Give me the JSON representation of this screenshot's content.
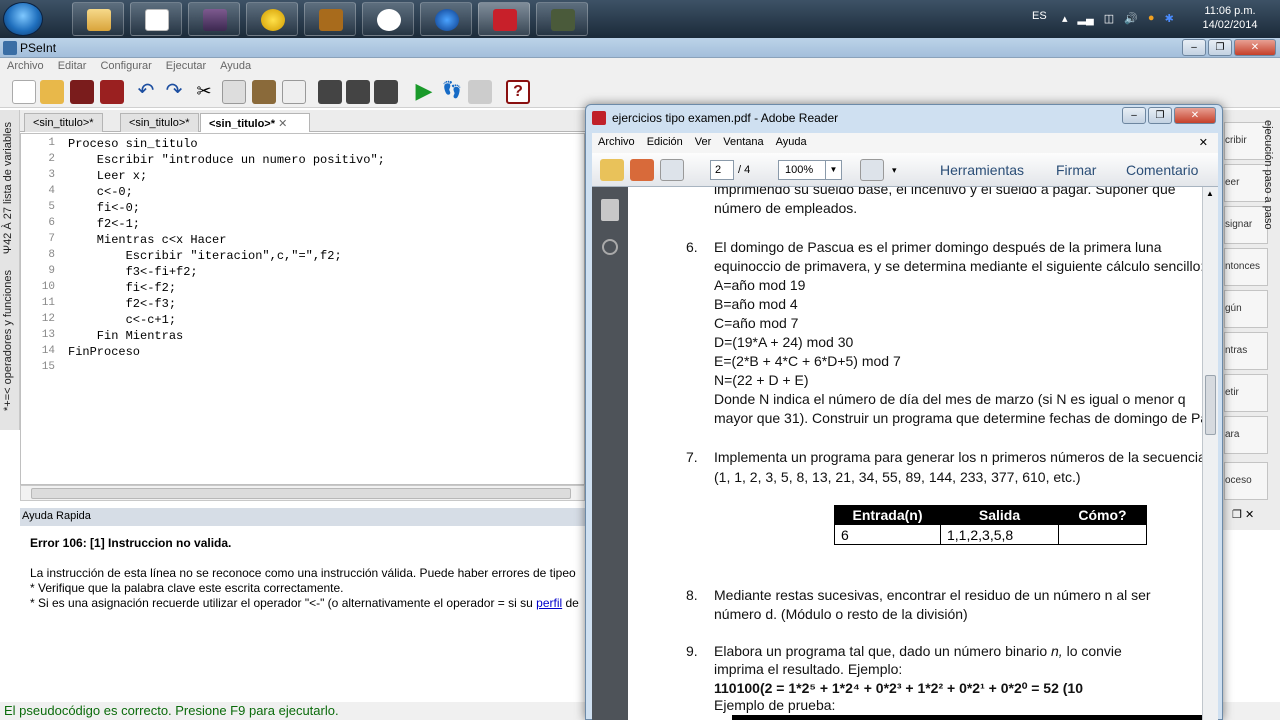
{
  "taskbar": {
    "language": "ES",
    "clock_time": "11:06 p.m.",
    "clock_date": "14/02/2014",
    "apps": [
      "windows-explorer-icon",
      "pseint-icon",
      "winrar-icon",
      "zip-icon",
      "dosbox-icon",
      "network-icon",
      "globe-icon",
      "acrobat-icon",
      "vlc-icon"
    ]
  },
  "pseint": {
    "title": "PSeInt",
    "menu": [
      "Archivo",
      "Editar",
      "Configurar",
      "Ejecutar",
      "Ayuda"
    ],
    "tabs": [
      "<sin_titulo>*",
      "<sin_titulo>*",
      "<sin_titulo>*"
    ],
    "left_panel_1": "lista de variables",
    "left_panel_2": "operadores y funciones",
    "left_panel_1_icons": "*+=<",
    "left_panel_2_icons": "Ψ42 À 27",
    "code_lines": [
      {
        "n": "1",
        "text": "Proceso sin_titulo"
      },
      {
        "n": "2",
        "text": "    Escribir \"introduce un numero positivo\";"
      },
      {
        "n": "3",
        "text": "    Leer x;"
      },
      {
        "n": "4",
        "text": "    c<-0;"
      },
      {
        "n": "5",
        "text": "    fi<-0;"
      },
      {
        "n": "6",
        "text": "    f2<-1;"
      },
      {
        "n": "7",
        "text": "    Mientras c<x Hacer"
      },
      {
        "n": "8",
        "text": "        Escribir \"iteracion\",c,\"=\",f2;"
      },
      {
        "n": "9",
        "text": "        f3<-fi+f2;"
      },
      {
        "n": "10",
        "text": "        fi<-f2;"
      },
      {
        "n": "11",
        "text": "        f2<-f3;"
      },
      {
        "n": "12",
        "text": "        c<-c+1;"
      },
      {
        "n": "13",
        "text": "    Fin Mientras"
      },
      {
        "n": "14",
        "text": "FinProceso"
      },
      {
        "n": "15",
        "text": ""
      }
    ],
    "help_title": "Ayuda Rapida",
    "help_error": "Error 106: [1] Instruccion no valida.",
    "help_line1": "La instrucción de esta línea no se reconoce como una instrucción válida. Puede haber errores de tipeo",
    "help_line2": "* Verifique que la palabra clave este escrita correctamente.",
    "help_line3a": "* Si es una asignación recuerde utilizar el operador \"<-\" (o alternativamente el operador = si su ",
    "help_line3_link": "perfil",
    "help_line3b": " de",
    "status": "El pseudocódigo es correcto. Presione F9 para ejecutarlo.",
    "right_buttons": [
      "cribir",
      "eer",
      "signar",
      "ntonces",
      "gún",
      "ntras",
      "etir",
      "ara",
      "oceso"
    ],
    "right_vertical": "ejecución paso a paso"
  },
  "adobe": {
    "title": "ejercicios tipo examen.pdf - Adobe Reader",
    "menu": [
      "Archivo",
      "Edición",
      "Ver",
      "Ventana",
      "Ayuda"
    ],
    "page_current": "2",
    "page_total": "/ 4",
    "zoom": "100%",
    "links": [
      "Herramientas",
      "Firmar",
      "Comentario"
    ],
    "doc": {
      "top1": "imprimiendo su sueldo base, el incentivo y el sueldo a pagar. Suponer que",
      "top2": "número de empleados.",
      "i6_num": "6.",
      "i6_l1": "El domingo de Pascua es el primer domingo después de la primera luna",
      "i6_l2": "equinoccio de primavera, y se determina mediante el siguiente cálculo sencillo:",
      "i6_a": "A=año mod 19",
      "i6_b": "B=año mod 4",
      "i6_c": "C=año mod 7",
      "i6_d": "D=(19*A + 24) mod 30",
      "i6_e": "E=(2*B + 4*C + 6*D+5) mod 7",
      "i6_n": "N=(22 + D + E)",
      "i6_l3": "Donde N indica el número de día del mes de marzo (si N es igual o menor q",
      "i6_l4": "mayor que 31). Construir un programa que determine fechas de domingo de Pas",
      "i7_num": "7.",
      "i7_l1": "Implementa un programa para generar los n primeros números de la secuencia",
      "i7_l2": "(1, 1, 2, 3, 5, 8, 13, 21, 34, 55, 89, 144, 233, 377, 610,  etc.)",
      "table_headers": [
        "Entrada(n)",
        "Salida",
        "Cómo?"
      ],
      "table_row": [
        "6",
        "1,1,2,3,5,8",
        ""
      ],
      "i8_num": "8.",
      "i8_l1": "Mediante restas sucesivas, encontrar el residuo de un número n al ser",
      "i8_l2": "número d. (Módulo o resto de la división)",
      "i9_num": "9.",
      "i9_l1a": "Elabora un programa tal que, dado un número binario ",
      "i9_l1_n": "n,",
      "i9_l1b": " lo convie",
      "i9_l2": "imprima el resultado. Ejemplo:",
      "i9_formula": "110100(2 =   1*2⁵ + 1*2⁴ + 0*2³ + 1*2² + 0*2¹ + 0*2⁰  = 52 (10",
      "i9_l3": "Ejemplo de prueba:"
    }
  }
}
